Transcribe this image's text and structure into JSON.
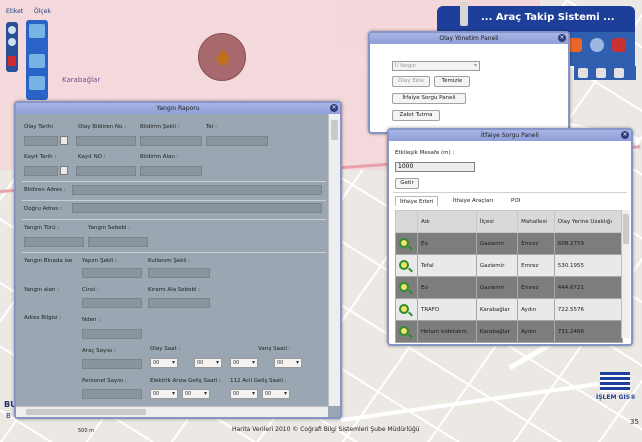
{
  "map": {
    "top_left_label": "Etiket",
    "top_left_label2": "Ölçek",
    "place_label": "Karabağlar",
    "bottom_left": "BU",
    "bottom_left2": "B",
    "scale_text": "500 m",
    "right_num": "35"
  },
  "header": {
    "title": "... Araç Takip Sistemi ..."
  },
  "olay_panel": {
    "title": "Olay Yönetim Paneli",
    "select_value": "İl Yangın",
    "buttons": {
      "olay_ekle": "Olay Ekle",
      "temizle": "Temizle",
      "itfaiye_sorgu": "İtfaiye Sorgu Paneli",
      "zabit": "Zabıt Tutma"
    }
  },
  "yangin": {
    "title": "Yangın Raporu",
    "labels": {
      "olay_tarihi": "Olay Tarihi",
      "olay_bildiren_no": "Olay Bildiren No :",
      "bildirim_sekli": "Bildirim Şekli :",
      "tel": "Tel :",
      "kayit_tarih": "Kayıt Tarih :",
      "kayit_no": "Kayıt NO :",
      "bildirim_alan": "Bildirim Alan :",
      "bildiren_adres": "Bildiren Adres :",
      "dogru_adres": "Doğru Adres :",
      "yangin_turu": "Yangın Türü :",
      "yangin_sebebi": "Yangın Sebebi :",
      "yangin_birinde": "Yangın Binada ise",
      "yapim_sekli": "Yapım Şekli :",
      "kullanim_sekli": "Kullanım Şekli :",
      "yangin_alan": "Yangın alan :",
      "cinsi": "Cinsi :",
      "kirim_sebebi": "Kıramı Ala Sebebi :",
      "nden": "Nden :",
      "adres_bilgisi": "Adres Bilgisi :",
      "arac_sayisi": "Araç Sayısı :",
      "olay_saat": "Olay Saat :",
      "varis_saati": "Varış Saati :",
      "personel_sayisi": "Personel Sayısı :",
      "elektrik_ariza": "Elektrik Arıza Geliş Saati :",
      "gelis_saati": "112 Acil Geliş Saati :"
    },
    "time_selects": [
      "00",
      "00",
      "00",
      "00",
      "00",
      "00",
      "00",
      "00",
      "00"
    ]
  },
  "itfaiye": {
    "title": "İtfaiye Sorgu Paneli",
    "mesafe_label": "Etkileşik Mesafe (m) :",
    "mesafe_value": "1000",
    "getir": "Getir",
    "tabs": [
      "İtfaiye Erleri",
      "İtfaiye Araçları",
      "POI"
    ],
    "columns": [
      "Adı",
      "İlçesi",
      "Mahallesi",
      "Olay Yerine Uzaklığı"
    ],
    "rows": [
      {
        "adi": "Eo",
        "ilce": "Gaziemir",
        "mahalle": "Emrez",
        "uzaklik": "608.2759"
      },
      {
        "adi": "Tefal",
        "ilce": "Gaziemir",
        "mahalle": "Emrez",
        "uzaklik": "530.1955"
      },
      {
        "adi": "Eo",
        "ilce": "Gaziemir",
        "mahalle": "Emrez",
        "uzaklik": "444.6721"
      },
      {
        "adi": "TRAFO",
        "ilce": "Karabağlar",
        "mahalle": "Aydın",
        "uzaklik": "722.5576"
      },
      {
        "adi": "Hetam kıdetakm",
        "ilce": "Karabağlar",
        "mahalle": "Aydın",
        "uzaklik": "731.2466"
      }
    ]
  },
  "footer": {
    "text": "Harita Verileri 2010 © Coğrafi Bilgi Sistemleri Şube Müdürlüğü"
  },
  "logo": {
    "text": "İŞLEM GIS®"
  }
}
